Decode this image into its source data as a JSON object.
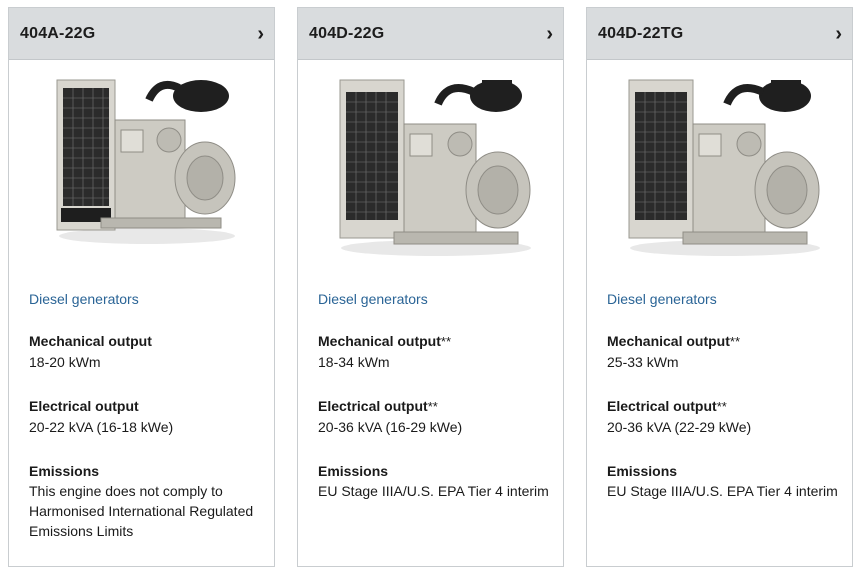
{
  "cards": [
    {
      "title": "404A-22G",
      "chevron": "›",
      "image_alt": "engine-404A-22G",
      "category": "Diesel generators",
      "mechanical_label": "Mechanical output",
      "mechanical_stars": "",
      "mechanical_value": "18-20 kWm",
      "electrical_label": "Electrical output",
      "electrical_stars": "",
      "electrical_value": "20-22 kVA (16-18 kWe)",
      "emissions_label": "Emissions",
      "emissions_value": "This engine does not comply to Harmonised International Regulated Emissions Limits"
    },
    {
      "title": "404D-22G",
      "chevron": "›",
      "image_alt": "engine-404D-22G",
      "category": "Diesel generators",
      "mechanical_label": "Mechanical output",
      "mechanical_stars": "**",
      "mechanical_value": "18-34 kWm",
      "electrical_label": "Electrical output",
      "electrical_stars": "**",
      "electrical_value": "20-36 kVA (16-29 kWe)",
      "emissions_label": "Emissions",
      "emissions_value": "EU Stage IIIA/U.S. EPA Tier 4 interim"
    },
    {
      "title": "404D-22TG",
      "chevron": "›",
      "image_alt": "engine-404D-22TG",
      "category": "Diesel generators",
      "mechanical_label": "Mechanical output",
      "mechanical_stars": "**",
      "mechanical_value": "25-33 kWm",
      "electrical_label": "Electrical output",
      "electrical_stars": "**",
      "electrical_value": "20-36 kVA (22-29 kWe)",
      "emissions_label": "Emissions",
      "emissions_value": "EU Stage IIIA/U.S. EPA Tier 4 interim"
    }
  ],
  "colors": {
    "header_bg": "#d9dcde",
    "link": "#2a6496",
    "border": "#c9cdd0"
  }
}
